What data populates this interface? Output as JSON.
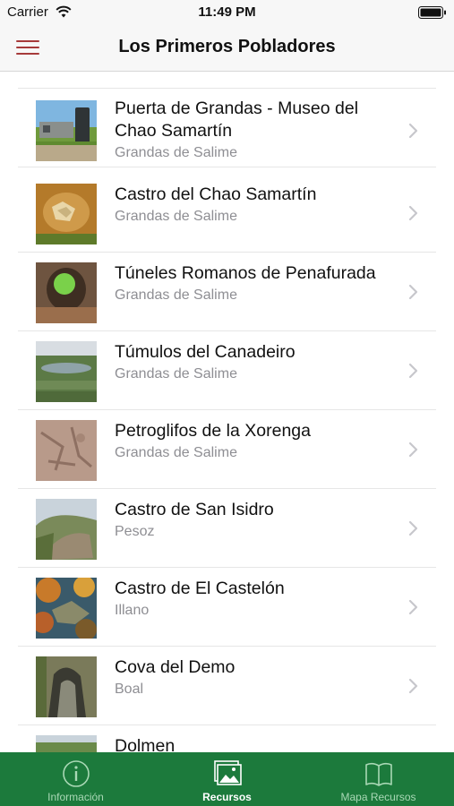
{
  "status_bar": {
    "carrier": "Carrier",
    "time": "11:49 PM"
  },
  "nav": {
    "title": "Los Primeros Pobladores",
    "menu_icon": "hamburger-menu-icon",
    "accent_color": "#a63a3a"
  },
  "list": {
    "items": [
      {
        "title": "Puerta de Grandas - Museo del Chao Samartín",
        "subtitle": "Grandas de Salime",
        "thumb": "museum-photo"
      },
      {
        "title": "Castro del Chao Samartín",
        "subtitle": "Grandas de Salime",
        "thumb": "castro-aerial-photo"
      },
      {
        "title": "Túneles Romanos de Penafurada",
        "subtitle": "Grandas de Salime",
        "thumb": "tunnel-photo"
      },
      {
        "title": "Túmulos del Canadeiro",
        "subtitle": "Grandas de Salime",
        "thumb": "tumulus-photo"
      },
      {
        "title": "Petroglifos de la Xorenga",
        "subtitle": "Grandas de Salime",
        "thumb": "petroglyph-photo"
      },
      {
        "title": "Castro de San Isidro",
        "subtitle": "Pesoz",
        "thumb": "hill-castro-photo"
      },
      {
        "title": "Castro de El Castelón",
        "subtitle": "Illano",
        "thumb": "autumn-castro-photo"
      },
      {
        "title": "Cova del Demo",
        "subtitle": "Boal",
        "thumb": "cave-photo"
      },
      {
        "title": "Dolmen",
        "subtitle": "",
        "thumb": "dolmen-photo"
      }
    ]
  },
  "tab_bar": {
    "background_color": "#1c7a3c",
    "tabs": [
      {
        "label": "Información",
        "icon": "info-circle-icon",
        "active": false
      },
      {
        "label": "Recursos",
        "icon": "photos-icon",
        "active": true
      },
      {
        "label": "Mapa Recursos",
        "icon": "map-book-icon",
        "active": false
      }
    ]
  }
}
